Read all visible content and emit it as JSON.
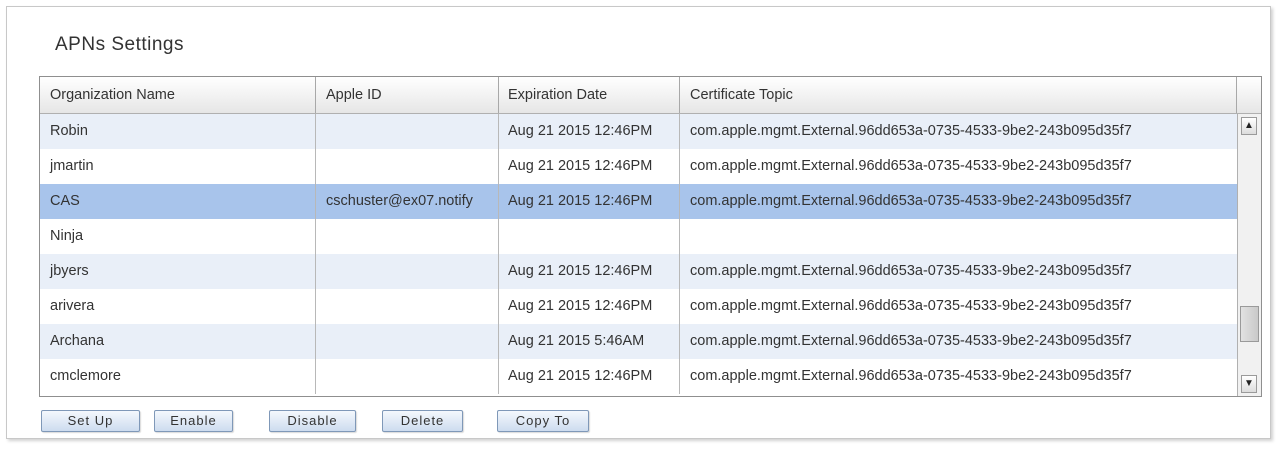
{
  "title": "APNs Settings",
  "columns": [
    "Organization Name",
    "Apple ID",
    "Expiration Date",
    "Certificate Topic"
  ],
  "rows": [
    {
      "org": "Robin",
      "apple_id": "",
      "expires": "Aug 21 2015 12:46PM",
      "topic": "com.apple.mgmt.External.96dd653a-0735-4533-9be2-243b095d35f7"
    },
    {
      "org": "jmartin",
      "apple_id": "",
      "expires": "Aug 21 2015 12:46PM",
      "topic": "com.apple.mgmt.External.96dd653a-0735-4533-9be2-243b095d35f7"
    },
    {
      "org": "CAS",
      "apple_id": "cschuster@ex07.notify",
      "expires": "Aug 21 2015 12:46PM",
      "topic": "com.apple.mgmt.External.96dd653a-0735-4533-9be2-243b095d35f7"
    },
    {
      "org": "Ninja",
      "apple_id": "",
      "expires": "",
      "topic": ""
    },
    {
      "org": "jbyers",
      "apple_id": "",
      "expires": "Aug 21 2015 12:46PM",
      "topic": "com.apple.mgmt.External.96dd653a-0735-4533-9be2-243b095d35f7"
    },
    {
      "org": "arivera",
      "apple_id": "",
      "expires": "Aug 21 2015 12:46PM",
      "topic": "com.apple.mgmt.External.96dd653a-0735-4533-9be2-243b095d35f7"
    },
    {
      "org": "Archana",
      "apple_id": "",
      "expires": "Aug 21 2015  5:46AM",
      "topic": "com.apple.mgmt.External.96dd653a-0735-4533-9be2-243b095d35f7"
    },
    {
      "org": "cmclemore",
      "apple_id": "",
      "expires": "Aug 21 2015 12:46PM",
      "topic": "com.apple.mgmt.External.96dd653a-0735-4533-9be2-243b095d35f7"
    }
  ],
  "selected_row": 2,
  "scrollbar": {
    "up_icon": "arrow-up-icon",
    "down_icon": "arrow-down-icon",
    "up_glyph": "▲",
    "down_glyph": "▼"
  },
  "buttons": {
    "setup": "Set Up",
    "enable": "Enable",
    "disable": "Disable",
    "delete": "Delete",
    "copy_to": "Copy To"
  },
  "colors": {
    "selected_row": "#a8c4eb",
    "alt_row": "#e9eff8",
    "button_border": "#7f98b8"
  }
}
